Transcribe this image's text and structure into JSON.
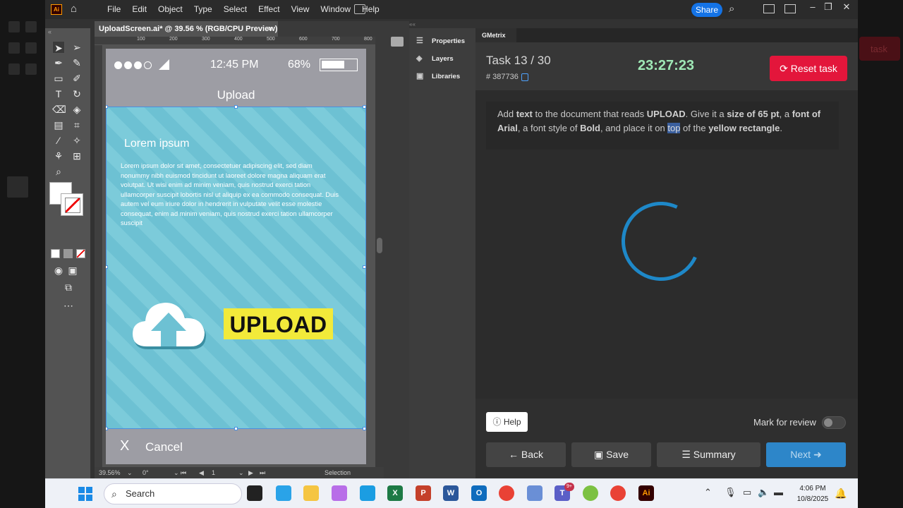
{
  "menubar": {
    "app_logo": "Ai",
    "items": [
      "File",
      "Edit",
      "Object",
      "Type",
      "Select",
      "Effect",
      "View",
      "Window",
      "Help"
    ],
    "share_label": "Share"
  },
  "document": {
    "tab_title": "UploadScreen.ai* @ 39.56 % (RGB/CPU Preview)",
    "close": "×",
    "ruler_marks": [
      "100",
      "200",
      "300",
      "400",
      "500",
      "600",
      "700",
      "800"
    ],
    "zoom": "39.56%",
    "rotation": "0°",
    "artboard_num": "1",
    "status_tool": "Selection"
  },
  "artboard": {
    "time": "12:45 PM",
    "battery_pct": "68%",
    "title": "Upload",
    "heading": "Lorem ipsum",
    "paragraph": "Lorem ipsum dolor sit amet, consectetuer adipiscing elit, sed diam nonummy nibh euismod tincidunt ut laoreet dolore magna aliquam erat volutpat. Ut wisi enim ad minim veniam, quis nostrud exerci tation ullamcorper suscipit lobortis nisl ut aliquip ex ea commodo consequat. Duis autem vel eum iriure dolor in hendrerit in vulputate velit esse molestie consequat, enim ad minim veniam, quis nostrud exerci tation ullamcorper suscipit",
    "upload_text": "UPLOAD",
    "cancel_x": "X",
    "cancel_label": "Cancel",
    "colors": {
      "content_bg": "#6dc1d3",
      "upload_box": "#f2ea3a"
    }
  },
  "panels": {
    "properties": "Properties",
    "layers": "Layers",
    "libraries": "Libraries"
  },
  "gmetrix": {
    "tab": "GMetrix",
    "task_label": "Task 13 / 30",
    "task_id": "# 387736",
    "timer": "23:27:23",
    "reset_label": "Reset task",
    "instruction": {
      "p1": "Add ",
      "b1": "text",
      "p2": " to the document that reads ",
      "b2": "UPLOAD",
      "p3": ". Give it a ",
      "b3": "size of 65 pt",
      "p4": ", a ",
      "b4": "font of Arial",
      "p5": ", a font style of ",
      "b5": "Bold",
      "p6": ", and place it on ",
      "hl": "top",
      "p7": " of the ",
      "b6": "yellow rectangle",
      "p8": "."
    },
    "progress_fraction": 0.43,
    "help_label": "Help",
    "mark_review_label": "Mark for review",
    "back_label": "Back",
    "save_label": "Save",
    "summary_label": "Summary",
    "next_label": "Next",
    "colors": {
      "reset": "#e3163b",
      "timer": "#9fe8b6",
      "progress": "#2ecc71",
      "next": "#2d86c9"
    }
  },
  "taskbar": {
    "search_placeholder": "Search",
    "time": "4:06 PM",
    "date": "10/8/2025",
    "teams_badge": "9+"
  },
  "background": {
    "ghost_button": "task"
  }
}
